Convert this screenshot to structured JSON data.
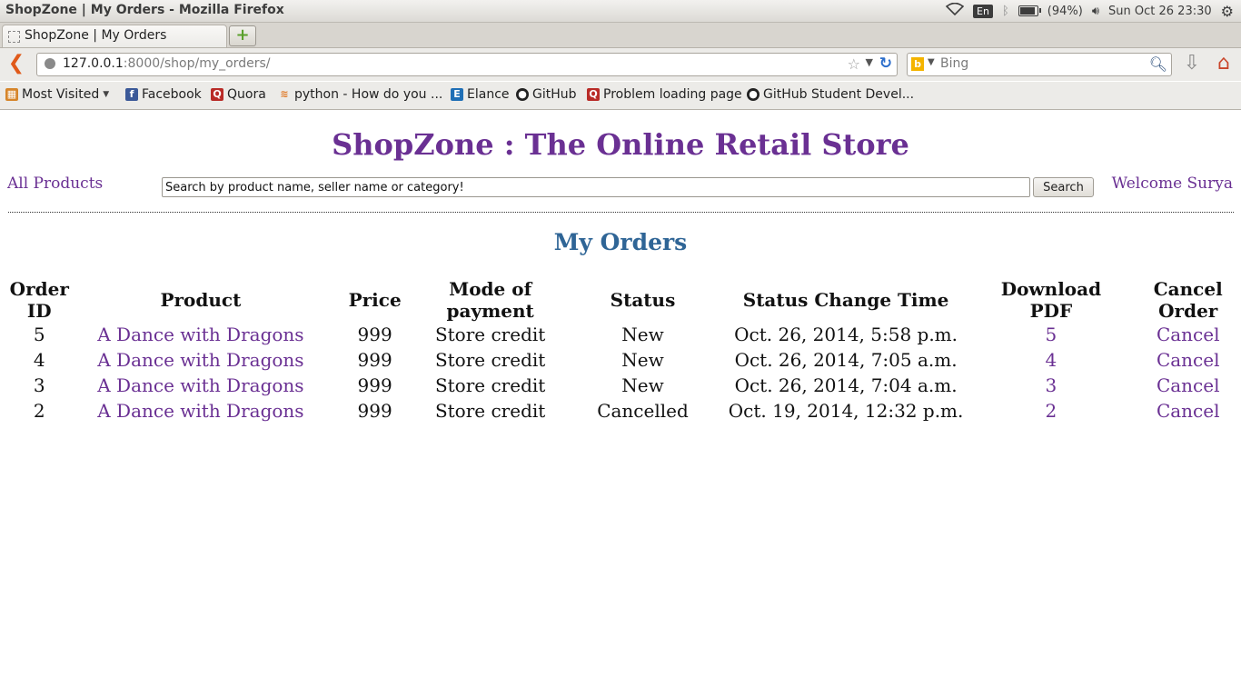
{
  "window": {
    "title": "ShopZone | My Orders - Mozilla Firefox"
  },
  "system_tray": {
    "language": "En",
    "battery_text": "(94%)",
    "battery_level": 0.94,
    "datetime": "Sun Oct 26 23:30"
  },
  "browser": {
    "tab_title": "ShopZone | My Orders",
    "url_host": "127.0.0.1",
    "url_path": ":8000/shop/my_orders/",
    "search_engine": "Bing",
    "bookmarks": [
      {
        "label": "Most Visited",
        "icon": "most-visited-icon",
        "glyph": "▦"
      },
      {
        "label": "Facebook",
        "icon": "facebook-icon",
        "glyph": "f"
      },
      {
        "label": "Quora",
        "icon": "quora-icon",
        "glyph": "Q"
      },
      {
        "label": "python - How do you ...",
        "icon": "stackoverflow-icon",
        "glyph": "≋"
      },
      {
        "label": "Elance",
        "icon": "elance-icon",
        "glyph": "E"
      },
      {
        "label": "GitHub",
        "icon": "github-icon",
        "glyph": "●"
      },
      {
        "label": "Problem loading page",
        "icon": "quora-icon",
        "glyph": "Q"
      },
      {
        "label": "GitHub Student Devel...",
        "icon": "github-icon",
        "glyph": "●"
      }
    ]
  },
  "page": {
    "site_title": "ShopZone : The Online Retail Store",
    "nav": {
      "all_products": "All Products",
      "search_placeholder": "Search by product name, seller name or category!",
      "search_button": "Search",
      "welcome": "Welcome Surya"
    },
    "section_title": "My Orders",
    "table": {
      "headers": [
        "Order ID",
        "Product",
        "Price",
        "Mode of payment",
        "Status",
        "Status Change Time",
        "Download PDF",
        "Cancel Order"
      ],
      "rows": [
        {
          "order_id": "5",
          "product": "A Dance with Dragons",
          "price": "999",
          "payment": "Store credit",
          "status": "New",
          "time": "Oct. 26, 2014, 5:58 p.m.",
          "pdf": "5",
          "cancel": "Cancel"
        },
        {
          "order_id": "4",
          "product": "A Dance with Dragons",
          "price": "999",
          "payment": "Store credit",
          "status": "New",
          "time": "Oct. 26, 2014, 7:05 a.m.",
          "pdf": "4",
          "cancel": "Cancel"
        },
        {
          "order_id": "3",
          "product": "A Dance with Dragons",
          "price": "999",
          "payment": "Store credit",
          "status": "New",
          "time": "Oct. 26, 2014, 7:04 a.m.",
          "pdf": "3",
          "cancel": "Cancel"
        },
        {
          "order_id": "2",
          "product": "A Dance with Dragons",
          "price": "999",
          "payment": "Store credit",
          "status": "Cancelled",
          "time": "Oct. 19, 2014, 12:32 p.m.",
          "pdf": "2",
          "cancel": "Cancel"
        }
      ]
    }
  },
  "colors": {
    "brand_purple": "#6a3093",
    "section_blue": "#2f6596"
  }
}
